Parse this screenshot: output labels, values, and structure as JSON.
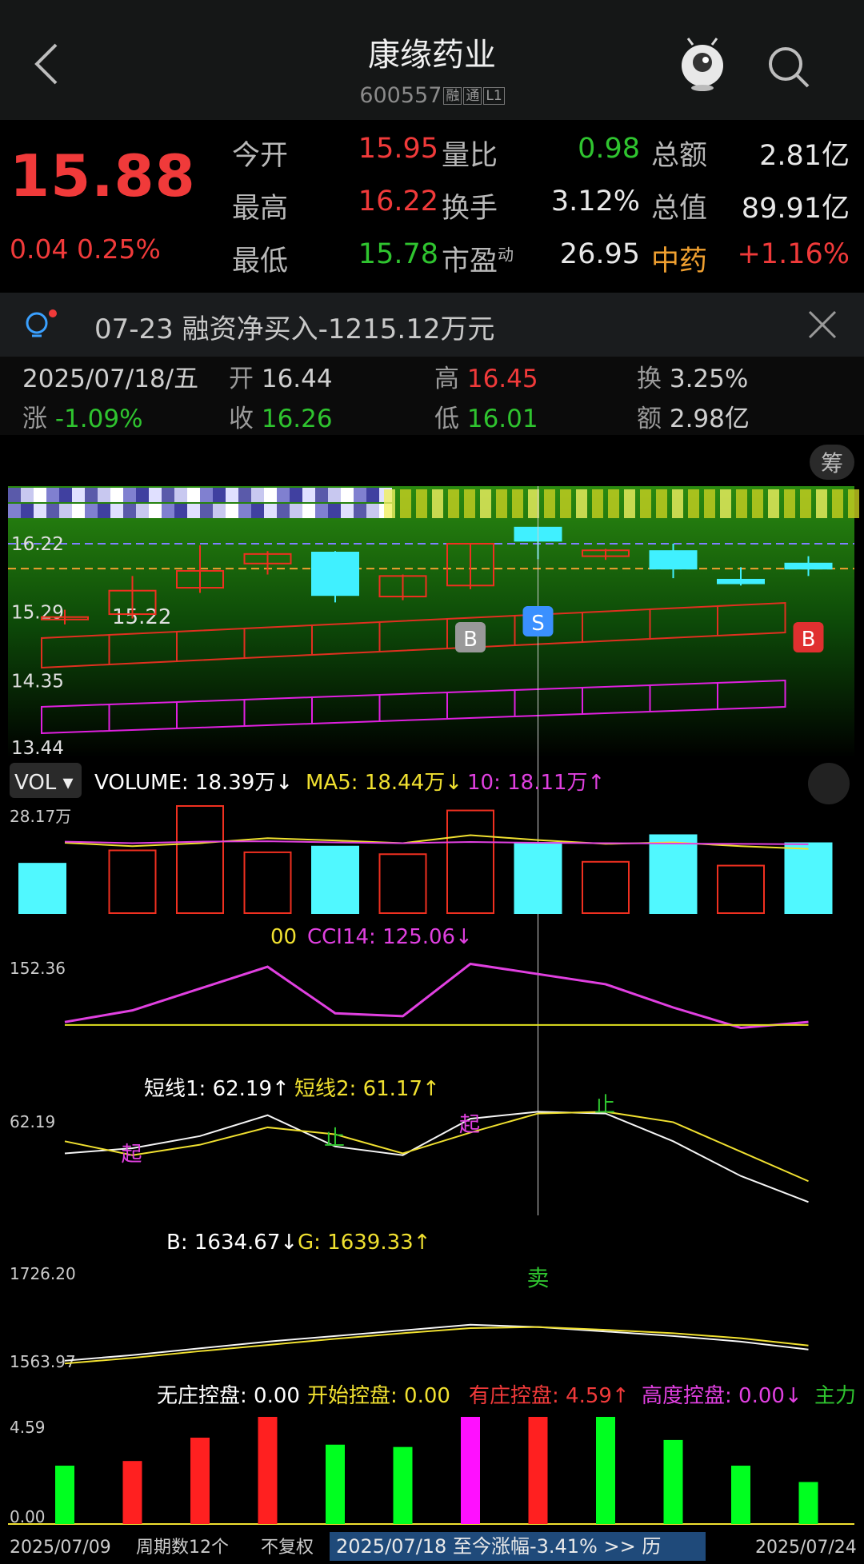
{
  "header": {
    "title": "康缘药业",
    "code": "600557",
    "tags": [
      "融",
      "通",
      "L1"
    ]
  },
  "quote": {
    "price": "15.88",
    "change": "0.04",
    "change_pct": "0.25%",
    "rows": [
      [
        {
          "label": "今开",
          "value": "15.95",
          "color": "#f03a3a"
        },
        {
          "label": "量比",
          "value": "0.98",
          "color": "#2fc42f"
        },
        {
          "label": "总额",
          "value": "2.81亿",
          "color": "#e8e8e8"
        }
      ],
      [
        {
          "label": "最高",
          "value": "16.22",
          "color": "#f03a3a"
        },
        {
          "label": "换手",
          "value": "3.12%",
          "color": "#e8e8e8"
        },
        {
          "label": "总值",
          "value": "89.91亿",
          "color": "#e8e8e8"
        }
      ],
      [
        {
          "label": "最低",
          "value": "15.78",
          "color": "#2fc42f"
        },
        {
          "label": "市盈",
          "label_sup": "动",
          "value": "26.95",
          "color": "#e8e8e8"
        },
        {
          "label": "中药",
          "label_color": "#f0a030",
          "value": "+1.16%",
          "color": "#f03a3a"
        }
      ]
    ]
  },
  "notice": {
    "text": "07-23 融资净买入-1215.12万元"
  },
  "day_info": {
    "date": "2025/07/18/五",
    "change_label": "涨",
    "change_value": "-1.09%",
    "open_label": "开",
    "open_value": "16.44",
    "close_label": "收",
    "close_value": "16.26",
    "high_label": "高",
    "high_value": "16.45",
    "low_label": "低",
    "low_value": "16.01",
    "turnover_label": "换",
    "turnover_value": "3.25%",
    "amount_label": "额",
    "amount_value": "2.98亿"
  },
  "main_chart": {
    "chip_button": "筹",
    "y_labels": [
      "16.22",
      "15.29",
      "15.22",
      "14.35",
      "13.44"
    ],
    "markers": [
      "B",
      "S",
      "B"
    ],
    "candles": [
      {
        "o": 15.2,
        "c": 15.22,
        "h": 15.32,
        "l": 15.12
      },
      {
        "o": 15.26,
        "c": 15.58,
        "h": 15.78,
        "l": 15.2
      },
      {
        "o": 15.62,
        "c": 15.85,
        "h": 16.2,
        "l": 15.55
      },
      {
        "o": 15.95,
        "c": 16.08,
        "h": 16.12,
        "l": 15.8
      },
      {
        "o": 16.1,
        "c": 15.52,
        "h": 16.12,
        "l": 15.42
      },
      {
        "o": 15.5,
        "c": 15.78,
        "h": 15.8,
        "l": 15.45
      },
      {
        "o": 15.65,
        "c": 16.22,
        "h": 16.22,
        "l": 15.6
      },
      {
        "o": 16.44,
        "c": 16.26,
        "h": 16.45,
        "l": 16.01
      },
      {
        "o": 16.05,
        "c": 16.13,
        "h": 16.15,
        "l": 16.0
      },
      {
        "o": 16.12,
        "c": 15.88,
        "h": 16.22,
        "l": 15.75
      },
      {
        "o": 15.73,
        "c": 15.68,
        "h": 15.9,
        "l": 15.65
      },
      {
        "o": 15.95,
        "c": 15.88,
        "h": 16.05,
        "l": 15.78
      }
    ]
  },
  "vol": {
    "selector": "VOL",
    "volume": "VOLUME: 18.39万",
    "ma5": "MA5: 18.44万",
    "ma10": "10: 18.11万",
    "y_max": "28.17万",
    "bars": [
      13.0,
      16.5,
      28.17,
      16.0,
      17.5,
      15.5,
      27.0,
      18.5,
      13.5,
      20.5,
      12.5,
      18.39
    ],
    "bar_up": [
      false,
      true,
      true,
      true,
      false,
      true,
      true,
      false,
      true,
      false,
      true,
      false
    ],
    "ma5_line": [
      18.5,
      17.6,
      18.4,
      19.7,
      19.1,
      18.4,
      20.5,
      19.2,
      18.2,
      18.6,
      17.6,
      16.9
    ],
    "ma10_line": [
      18.8,
      18.4,
      18.8,
      18.9,
      18.6,
      18.4,
      18.7,
      18.5,
      18.4,
      18.3,
      18.2,
      18.11
    ]
  },
  "cci": {
    "label_tail": "00",
    "cci14": "CCI14: 125.06",
    "y_label": "152.36",
    "line": [
      112,
      120,
      135,
      150,
      118,
      116,
      152,
      145,
      138,
      122,
      108,
      112
    ],
    "base": [
      110,
      110,
      110,
      110,
      110,
      110,
      110,
      110,
      110,
      110,
      110,
      110
    ]
  },
  "short": {
    "line1": "短线1: 62.19",
    "line2": "短线2: 61.17",
    "y_label": "62.19",
    "s1": [
      38,
      41,
      48,
      60,
      42,
      37,
      58,
      62,
      61,
      45,
      25,
      10
    ],
    "s2": [
      45,
      37,
      43,
      53,
      49,
      38,
      50,
      61,
      62,
      56,
      39,
      22
    ],
    "annotations": [
      {
        "idx": 1,
        "text": "起",
        "color": "#e040e0"
      },
      {
        "idx": 4,
        "text": "止",
        "color": "#2fc42f"
      },
      {
        "idx": 6,
        "text": "起",
        "color": "#e040e0"
      },
      {
        "idx": 8,
        "text": "止",
        "color": "#2fc42f"
      }
    ]
  },
  "bg": {
    "b": "B: 1634.67",
    "g": "G: 1639.33",
    "y_max": "1726.20",
    "y_min": "1563.97",
    "sell": "卖",
    "b_line": [
      1570,
      1580,
      1592,
      1604,
      1614,
      1624,
      1634,
      1630,
      1622,
      1614,
      1604,
      1590
    ],
    "g_line": [
      1565,
      1575,
      1587,
      1598,
      1609,
      1619,
      1628,
      1630,
      1625,
      1619,
      1610,
      1597
    ]
  },
  "control": {
    "no_control": "无庄控盘: 0.00",
    "start_control": "开始控盘: 0.00",
    "has_control": "有庄控盘: 4.59",
    "high_control": "高度控盘: 0.00",
    "main_force": "主力",
    "y_max": "4.59",
    "y_min": "0.00",
    "bars": [
      2.5,
      2.7,
      3.7,
      4.59,
      3.4,
      3.3,
      4.59,
      4.59,
      4.59,
      3.6,
      2.5,
      1.8
    ],
    "colors": [
      "#00ff20",
      "#ff2020",
      "#ff2020",
      "#ff2020",
      "#00ff20",
      "#00ff20",
      "#ff10ff",
      "#ff2020",
      "#00ff20",
      "#00ff20",
      "#00ff20",
      "#00ff20"
    ]
  },
  "footer": {
    "start_date": "2025/07/09",
    "periods": "周期数12个",
    "adjust": "不复权",
    "range": "2025/07/18 至今涨幅-3.41%  >> 历",
    "end_date": "2025/07/24"
  }
}
